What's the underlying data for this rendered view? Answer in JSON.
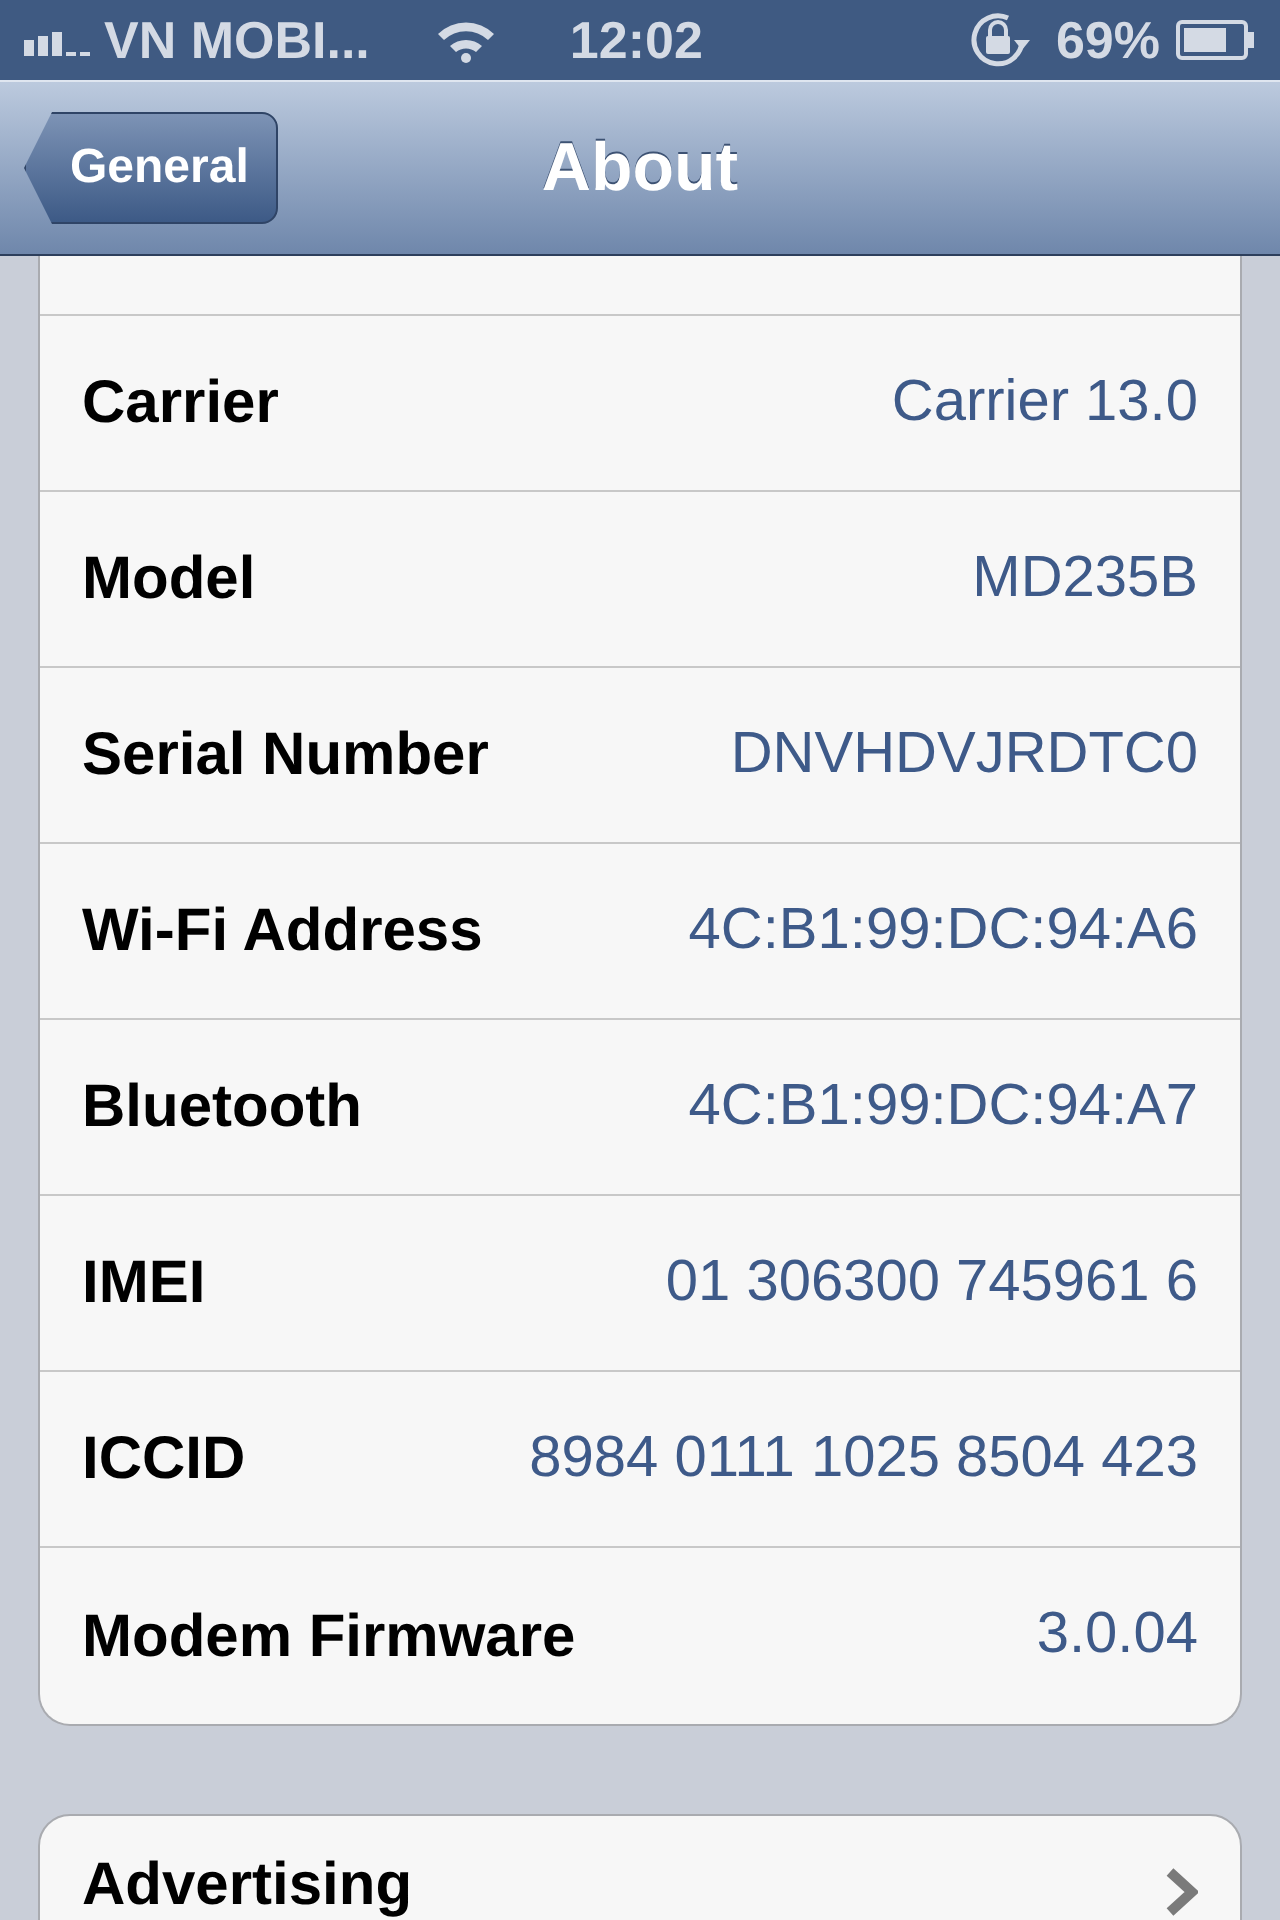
{
  "status_bar": {
    "carrier": "VN MOBI...",
    "time": "12:02",
    "battery": "69%"
  },
  "nav_bar": {
    "back_button": "General",
    "title": "About"
  },
  "rows": [
    {
      "label": "Carrier",
      "value": "Carrier 13.0"
    },
    {
      "label": "Model",
      "value": "MD235B"
    },
    {
      "label": "Serial Number",
      "value": "DNVHDVJRDTC0"
    },
    {
      "label": "Wi-Fi Address",
      "value": "4C:B1:99:DC:94:A6"
    },
    {
      "label": "Bluetooth",
      "value": "4C:B1:99:DC:94:A7"
    },
    {
      "label": "IMEI",
      "value": "01 306300 745961 6"
    },
    {
      "label": "ICCID",
      "value": "8984 0111 1025 8504 423"
    },
    {
      "label": "Modem Firmware",
      "value": "3.0.04"
    }
  ],
  "next_group": [
    {
      "label": "Advertising"
    }
  ]
}
